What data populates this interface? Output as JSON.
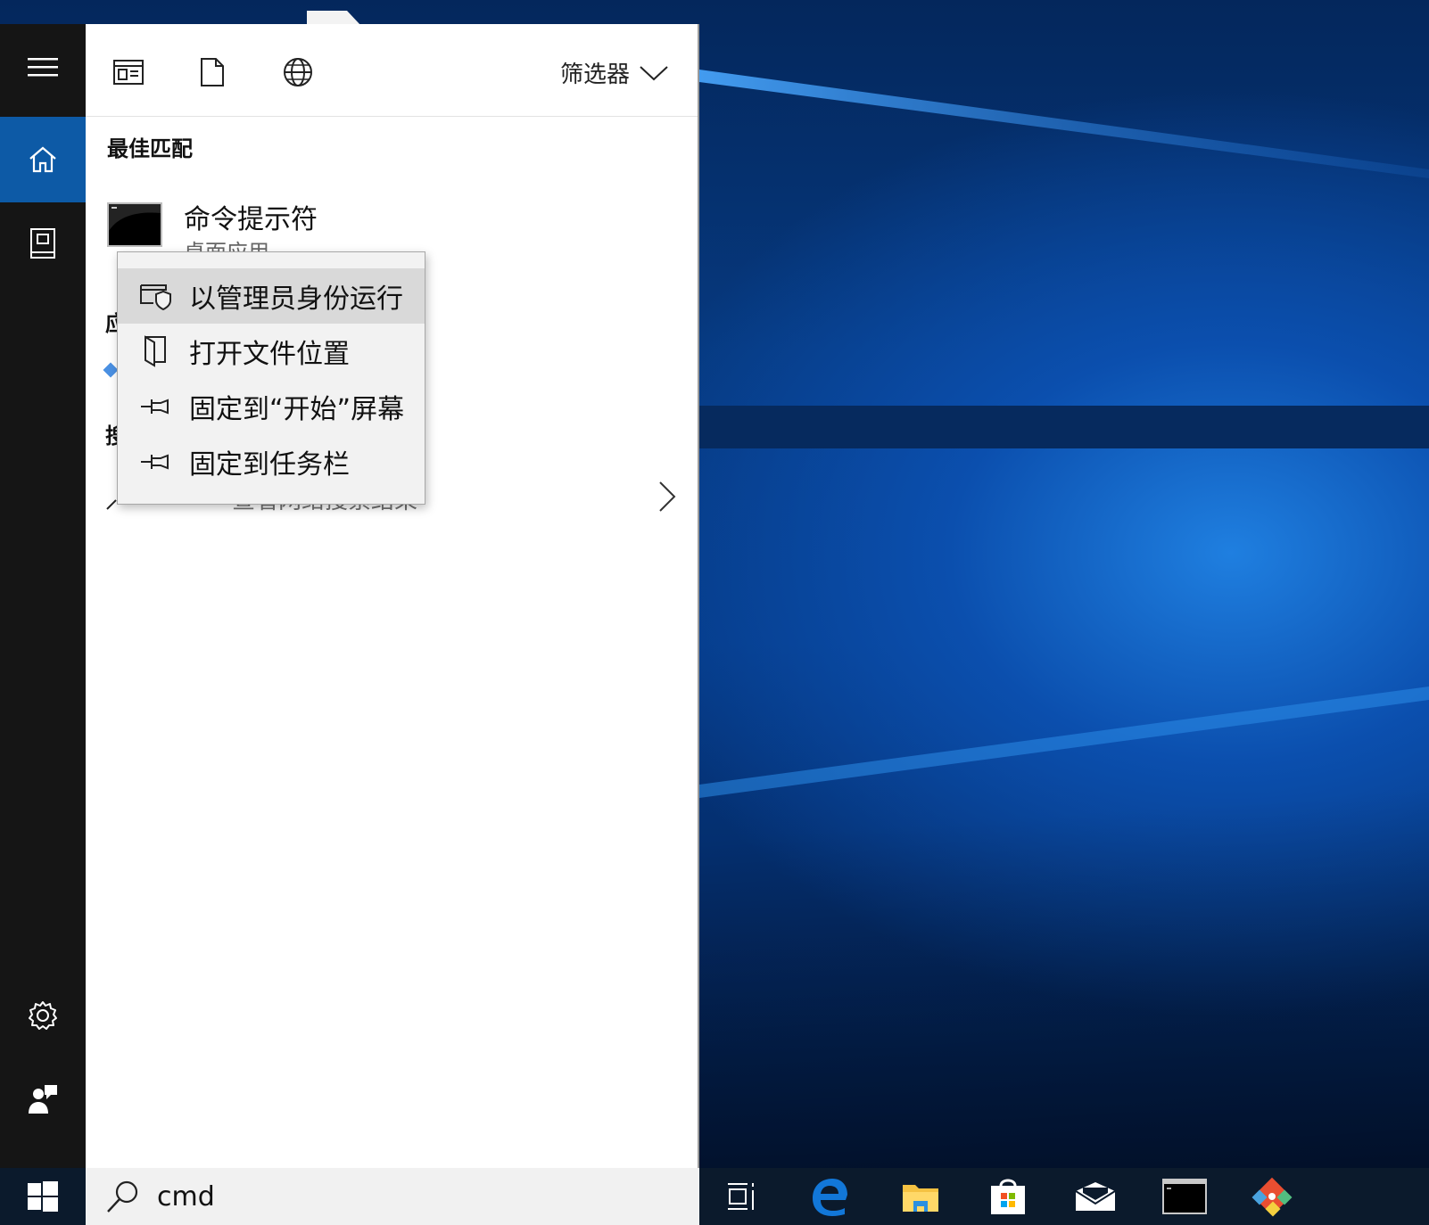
{
  "panel": {
    "filter_label": "筛选器",
    "best_match_heading": "最佳匹配",
    "best_match": {
      "title": "命令提示符",
      "subtitle": "桌面应用"
    },
    "apps_heading_partial": "应",
    "web_heading_partial": "搜",
    "web_result": {
      "query": "cmd",
      "hint": "查看网络搜索结果"
    }
  },
  "context_menu": {
    "items": [
      {
        "label": "以管理员身份运行",
        "icon": "shield-window-icon"
      },
      {
        "label": "打开文件位置",
        "icon": "folder-open-icon"
      },
      {
        "label": "固定到“开始”屏幕",
        "icon": "pin-icon"
      },
      {
        "label": "固定到任务栏",
        "icon": "pin-icon"
      }
    ]
  },
  "search": {
    "value": "cmd",
    "placeholder": ""
  },
  "taskbar": {
    "icons": [
      "task-view-icon",
      "edge-icon",
      "file-explorer-icon",
      "store-icon",
      "mail-icon",
      "command-prompt-icon",
      "git-icon"
    ]
  },
  "colors": {
    "accent": "#0d5aa6",
    "rail": "#151515",
    "menu_hover": "#d9d9d9",
    "taskbar": "#0b1a2c"
  }
}
